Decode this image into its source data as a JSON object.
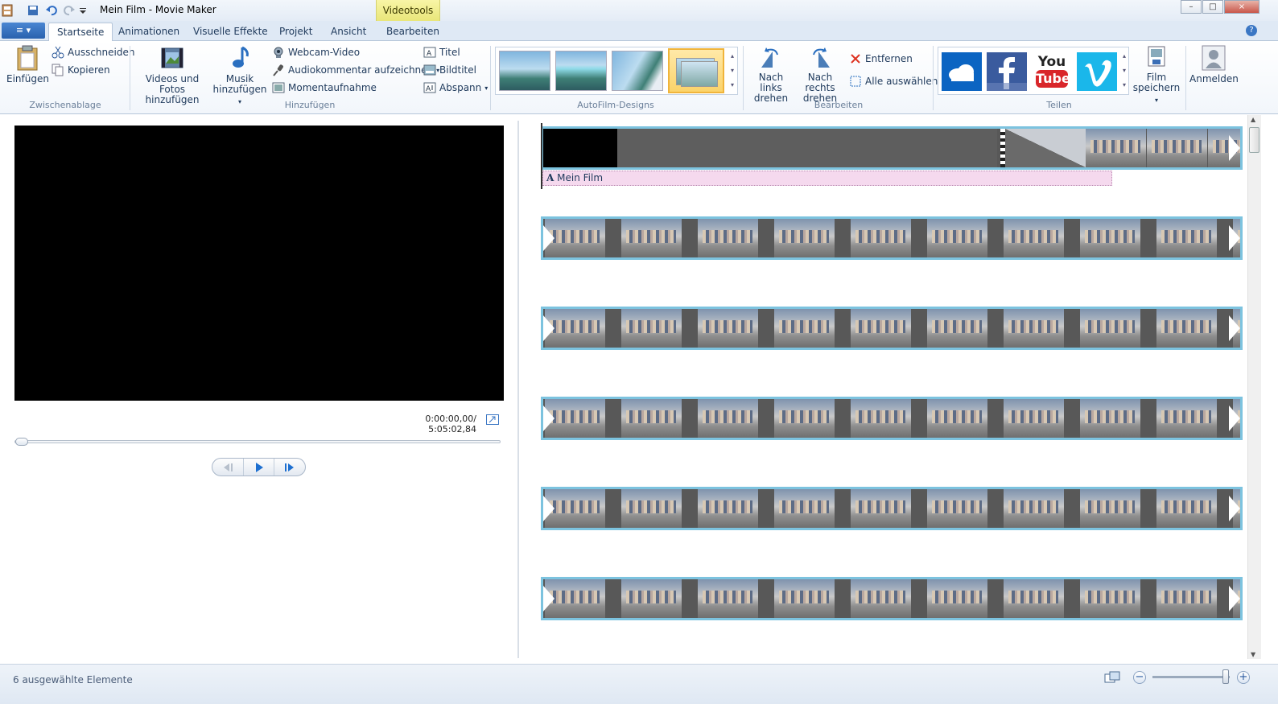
{
  "window": {
    "title": "Mein Film - Movie Maker",
    "context_tab": "Videotools",
    "controls": {
      "minimize": "–",
      "maximize": "□",
      "close": "×"
    }
  },
  "tabs": [
    "Startseite",
    "Animationen",
    "Visuelle Effekte",
    "Projekt",
    "Ansicht",
    "Bearbeiten"
  ],
  "active_tab": "Startseite",
  "file_button": "≡ ▾",
  "help": "?",
  "ribbon": {
    "zwischenablage": {
      "label": "Zwischenablage",
      "paste": "Einfügen",
      "cut": "Ausschneiden",
      "copy": "Kopieren"
    },
    "hinzufuegen": {
      "label": "Hinzufügen",
      "videos_line1": "Videos und Fotos",
      "videos_line2": "hinzufügen",
      "music_line1": "Musik",
      "music_line2": "hinzufügen",
      "webcam": "Webcam-Video",
      "audio_comment": "Audiokommentar aufzeichnen",
      "snapshot": "Momentaufnahme",
      "title": "Titel",
      "caption": "Bildtitel",
      "credits": "Abspann"
    },
    "autofilm": {
      "label": "AutoFilm-Designs"
    },
    "bearbeiten": {
      "label": "Bearbeiten",
      "rotate_left_line1": "Nach links",
      "rotate_left_line2": "drehen",
      "rotate_right_line1": "Nach rechts",
      "rotate_right_line2": "drehen",
      "remove": "Entfernen",
      "select_all": "Alle auswählen"
    },
    "teilen": {
      "label": "Teilen",
      "save_line1": "Film",
      "save_line2": "speichern",
      "share_targets": [
        "OneDrive",
        "Facebook",
        "YouTube",
        "Vimeo"
      ],
      "youtube_top": "You",
      "youtube_bottom": "Tube"
    },
    "signin": "Anmelden"
  },
  "player": {
    "timecode": "0:00:00,00/ 5:05:02,84",
    "position_fraction": 0.0
  },
  "timeline": {
    "caption_text": "Mein Film",
    "caption_marker": "A",
    "clip_rows": 6
  },
  "status": {
    "text": "6 ausgewählte Elemente",
    "zoom_minus": "−",
    "zoom_plus": "+",
    "zoom_fraction": 0.95
  },
  "colors": {
    "accent": "#3b77c4",
    "clip_border": "#7cc3df",
    "caption_bg": "#f5d9ee",
    "context_tab": "#e9e67a"
  }
}
